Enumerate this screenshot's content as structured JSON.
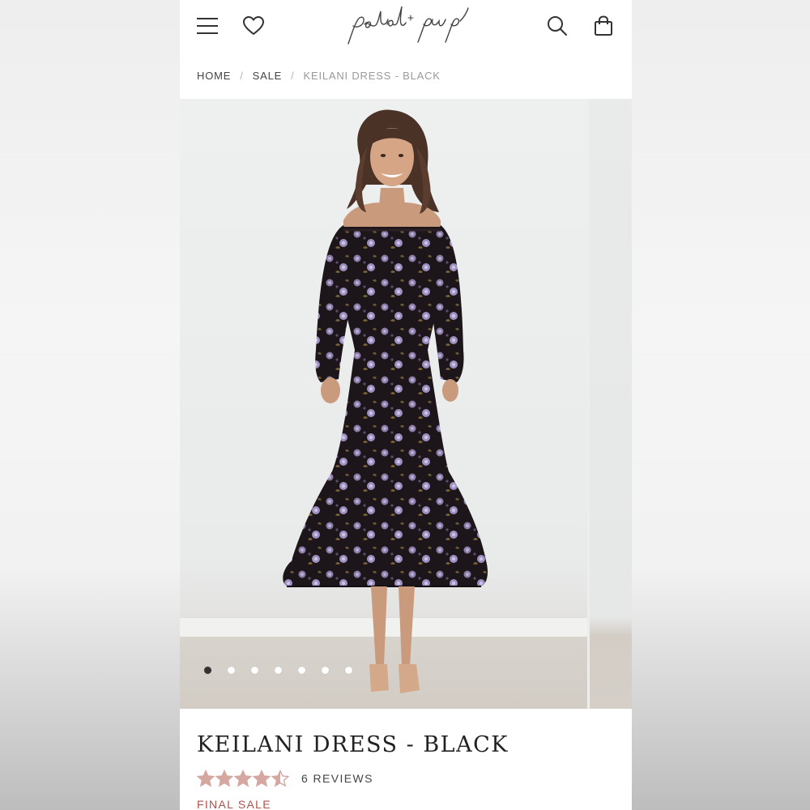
{
  "header": {
    "brand": "petal + pup",
    "menu_icon": "hamburger-menu-icon",
    "wishlist_icon": "heart-icon",
    "search_icon": "search-icon",
    "cart_icon": "shopping-bag-icon"
  },
  "breadcrumb": {
    "items": [
      "HOME",
      "SALE",
      "KEILANI DRESS - BLACK"
    ],
    "separator": "/"
  },
  "gallery": {
    "dot_count": 7,
    "active_index": 0
  },
  "product": {
    "title": "KEILANI DRESS - BLACK",
    "rating": 4.5,
    "rating_max": 5,
    "reviews_label": "6 REVIEWS",
    "status": "FINAL SALE"
  },
  "colors": {
    "star": "#d4a7a0",
    "sale": "#b0524c"
  }
}
